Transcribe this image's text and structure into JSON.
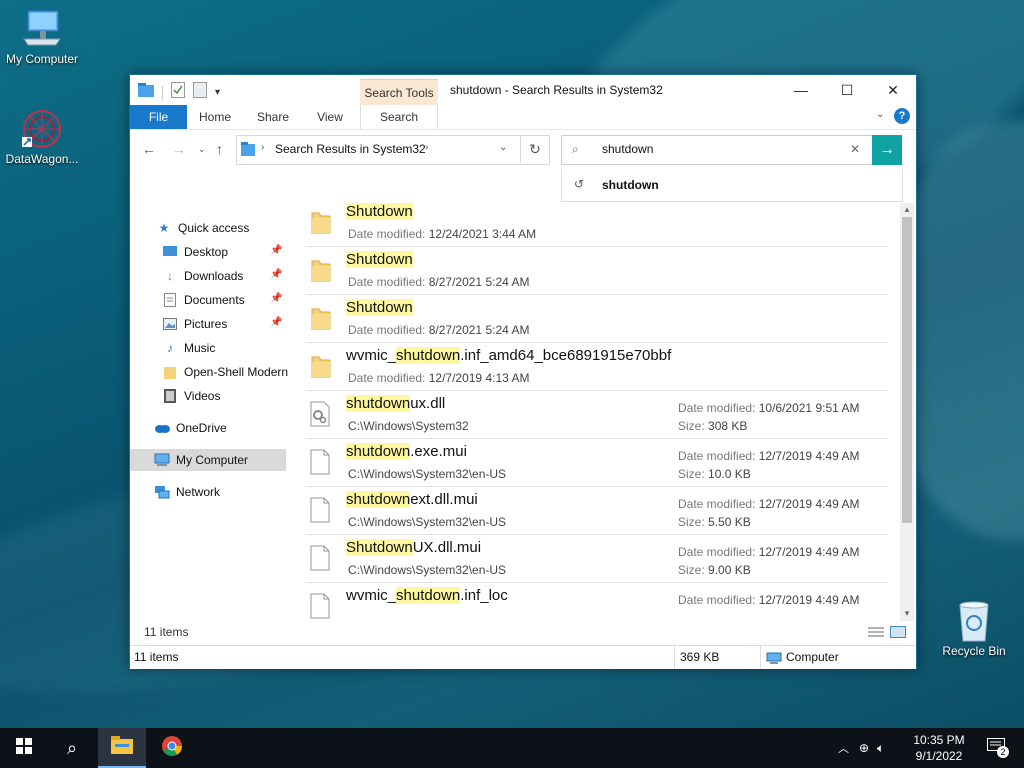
{
  "desktop": {
    "icons": [
      {
        "label": "My Computer"
      },
      {
        "label": "DataWagon..."
      },
      {
        "label": "Recycle Bin"
      }
    ]
  },
  "window": {
    "title": "shutdown - Search Results in System32",
    "context_tab": "Search Tools",
    "ribbon_tabs": [
      "File",
      "Home",
      "Share",
      "View",
      "Search"
    ],
    "address": {
      "crumb": "Search Results in System32"
    },
    "search": {
      "value": "shutdown",
      "suggestion": "shutdown"
    },
    "nav": {
      "quick_access": "Quick access",
      "items": [
        "Desktop",
        "Downloads",
        "Documents",
        "Pictures",
        "Music",
        "Open-Shell Modern",
        "Videos"
      ],
      "onedrive": "OneDrive",
      "my_computer": "My Computer",
      "network": "Network"
    },
    "labels": {
      "date_modified": "Date modified:",
      "size": "Size:"
    },
    "results": [
      {
        "pre": "",
        "hl": "Shutdown",
        "post": "",
        "sub": "12/24/2021 3:44 AM",
        "icon": "folder-icon"
      },
      {
        "pre": "",
        "hl": "Shutdown",
        "post": "",
        "sub": "8/27/2021 5:24 AM",
        "icon": "folder-icon"
      },
      {
        "pre": "",
        "hl": "Shutdown",
        "post": "",
        "sub": "8/27/2021 5:24 AM",
        "icon": "folder-icon"
      },
      {
        "pre": "wvmic_",
        "hl": "shutdown",
        "post": ".inf_amd64_bce6891915e70bbf",
        "sub": "12/7/2019 4:13 AM",
        "icon": "folder-icon"
      },
      {
        "pre": "",
        "hl": "shutdown",
        "post": "ux.dll",
        "sub": "C:\\Windows\\System32",
        "dm": "10/6/2021 9:51 AM",
        "sz": "308 KB",
        "icon": "dll-icon"
      },
      {
        "pre": "",
        "hl": "shutdown",
        "post": ".exe.mui",
        "sub": "C:\\Windows\\System32\\en-US",
        "dm": "12/7/2019 4:49 AM",
        "sz": "10.0 KB",
        "icon": "file-icon"
      },
      {
        "pre": "",
        "hl": "shutdown",
        "post": "ext.dll.mui",
        "sub": "C:\\Windows\\System32\\en-US",
        "dm": "12/7/2019 4:49 AM",
        "sz": "5.50 KB",
        "icon": "file-icon"
      },
      {
        "pre": "",
        "hl": "Shutdown",
        "post": "UX.dll.mui",
        "sub": "C:\\Windows\\System32\\en-US",
        "dm": "12/7/2019 4:49 AM",
        "sz": "9.00 KB",
        "icon": "file-icon"
      },
      {
        "pre": "wvmic_",
        "hl": "shutdown",
        "post": ".inf_loc",
        "sub": "",
        "dm": "12/7/2019 4:49 AM",
        "sz": "",
        "icon": "file-icon"
      }
    ],
    "items_count": "11 items",
    "status": {
      "items": "11 items",
      "size": "369 KB",
      "location": "Computer"
    }
  },
  "taskbar": {
    "time": "10:35 PM",
    "date": "9/1/2022",
    "notification_count": "2"
  }
}
